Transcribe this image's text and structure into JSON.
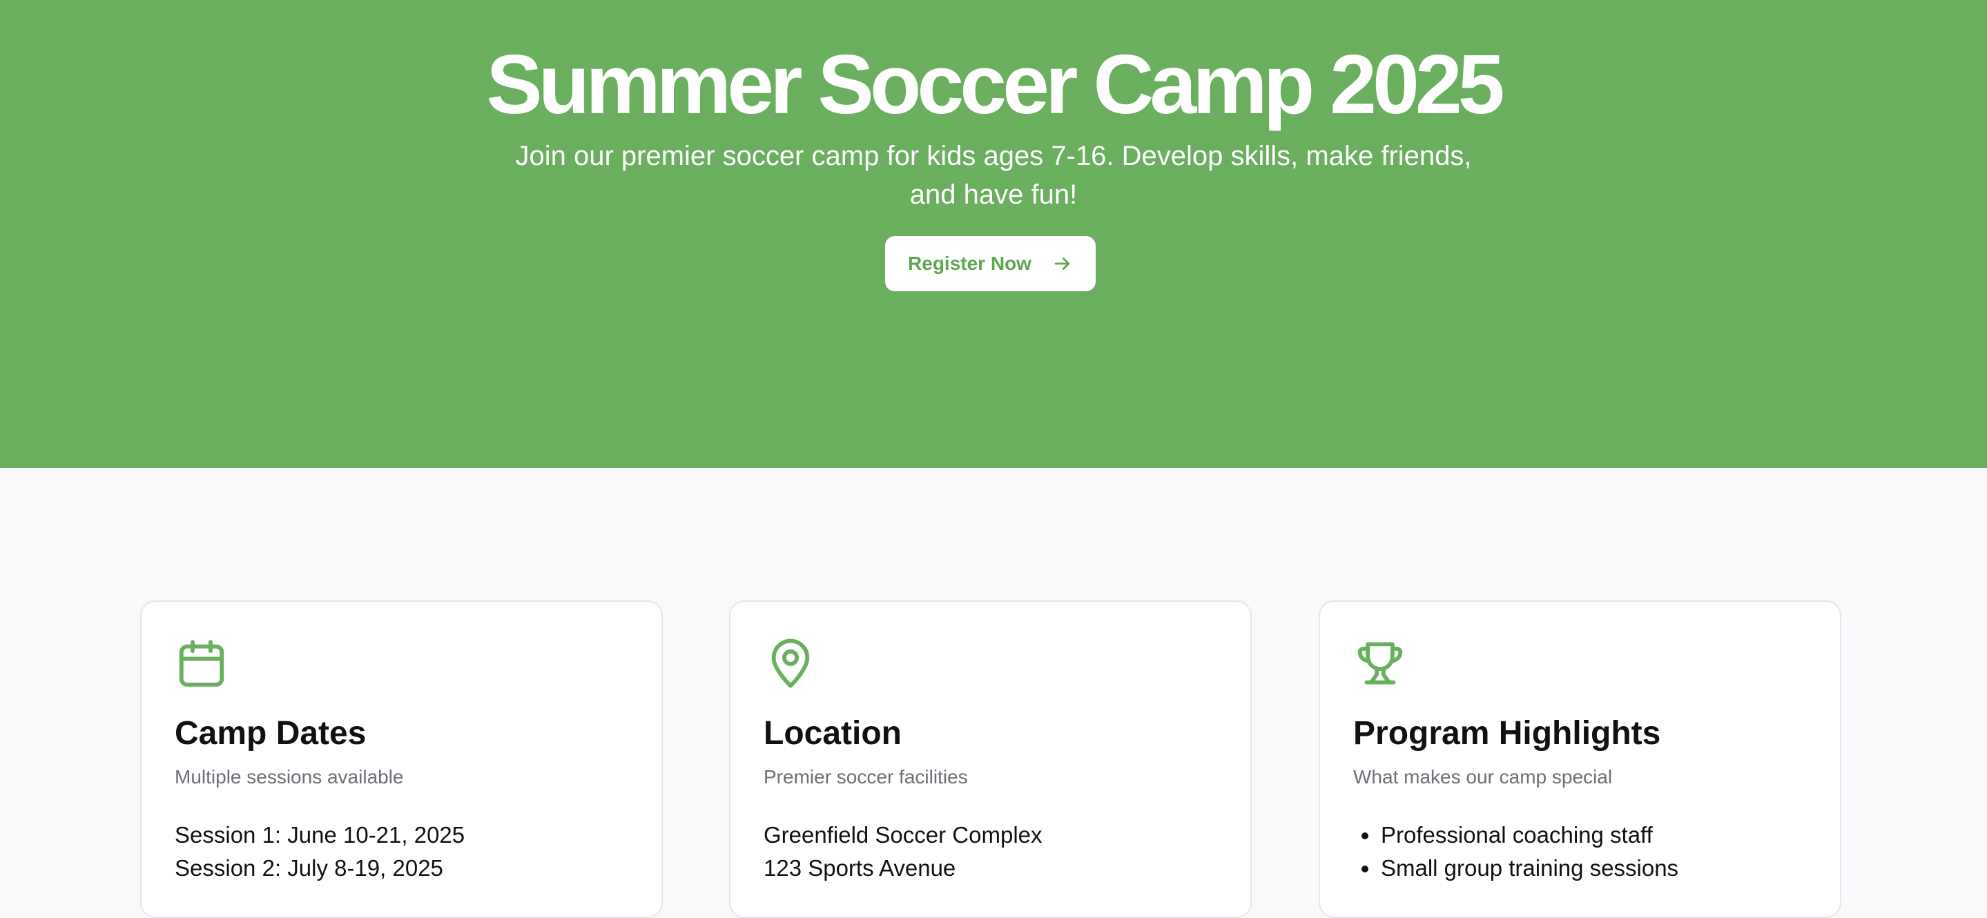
{
  "hero": {
    "title": "Summer Soccer Camp 2025",
    "subtitle": "Join our premier soccer camp for kids ages 7-16. Develop skills, make friends, and have fun!",
    "register_label": "Register Now",
    "register_icon": "arrow-right-icon"
  },
  "cards": [
    {
      "icon": "calendar-icon",
      "title": "Camp Dates",
      "description": "Multiple sessions available",
      "lines": [
        "Session 1: June 10-21, 2025",
        "Session 2: July 8-19, 2025"
      ]
    },
    {
      "icon": "map-pin-icon",
      "title": "Location",
      "description": "Premier soccer facilities",
      "lines": [
        "Greenfield Soccer Complex",
        "123 Sports Avenue"
      ]
    },
    {
      "icon": "trophy-icon",
      "title": "Program Highlights",
      "description": "What makes our camp special",
      "items": [
        "Professional coaching staff",
        "Small group training sessions"
      ]
    }
  ],
  "colors": {
    "brand_green": "#69af5d",
    "page_background": "#f8f9fb",
    "card_border": "#e4e6ea",
    "muted_text": "#6b6f76"
  }
}
